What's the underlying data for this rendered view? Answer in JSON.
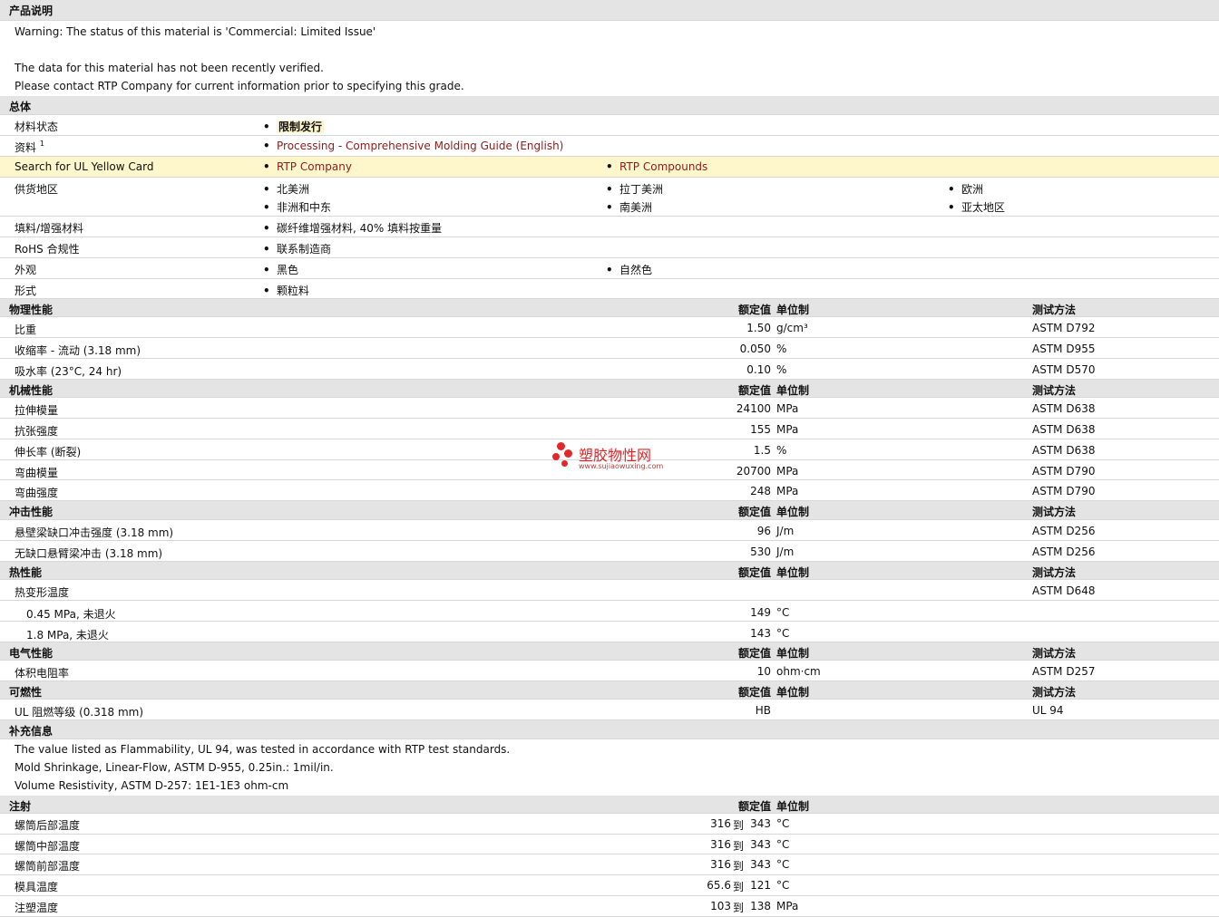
{
  "sections": {
    "product_desc": "产品说明",
    "general": "总体",
    "physical": "物理性能",
    "mechanical": "机械性能",
    "impact": "冲击性能",
    "thermal": "热性能",
    "electrical": "电气性能",
    "flammability": "可燃性",
    "additional": "补充信息",
    "injection": "注射"
  },
  "column_headers": {
    "nominal": "额定值",
    "unit": "单位制",
    "method": "测试方法"
  },
  "product_desc": {
    "line1": "Warning: The status of this material is 'Commercial: Limited Issue'",
    "line2": "The data for this material has not been recently verified.",
    "line3": "Please contact RTP Company for current information prior to specifying this grade."
  },
  "general": {
    "status_label": "材料状态",
    "status_value": "限制发行",
    "docs_label": "资料",
    "docs_sup": "1",
    "docs_link": "Processing - Comprehensive Molding Guide (English)",
    "ul_label": "Search for UL Yellow Card",
    "ul_link1": "RTP Company",
    "ul_link2": "RTP Compounds",
    "supply_label": "供货地区",
    "supply": [
      "北美洲",
      "拉丁美洲",
      "欧洲",
      "非洲和中东",
      "南美洲",
      "亚太地区"
    ],
    "filler_label": "填料/增强材料",
    "filler_value": "碳纤维增强材料, 40% 填料按重量",
    "rohs_label": "RoHS 合规性",
    "rohs_value": "联系制造商",
    "appearance_label": "外观",
    "appearance": [
      "黑色",
      "自然色"
    ],
    "form_label": "形式",
    "form_value": "颗粒料"
  },
  "physical": [
    {
      "name": "比重",
      "value": "1.50",
      "unit": "g/cm³",
      "method": "ASTM D792"
    },
    {
      "name": "收缩率  - 流动  (3.18 mm)",
      "value": "0.050",
      "unit": "%",
      "method": "ASTM D955"
    },
    {
      "name": "吸水率  (23°C, 24 hr)",
      "value": "0.10",
      "unit": "%",
      "method": "ASTM D570"
    }
  ],
  "mechanical": [
    {
      "name": "拉伸模量",
      "value": "24100",
      "unit": "MPa",
      "method": "ASTM D638"
    },
    {
      "name": "抗张强度",
      "value": "155",
      "unit": "MPa",
      "method": "ASTM D638"
    },
    {
      "name": "伸长率  (断裂)",
      "value": "1.5",
      "unit": "%",
      "method": "ASTM D638"
    },
    {
      "name": "弯曲模量",
      "value": "20700",
      "unit": "MPa",
      "method": "ASTM D790"
    },
    {
      "name": "弯曲强度",
      "value": "248",
      "unit": "MPa",
      "method": "ASTM D790"
    }
  ],
  "impact": [
    {
      "name": "悬壁梁缺口冲击强度  (3.18 mm)",
      "value": "96",
      "unit": "J/m",
      "method": "ASTM D256"
    },
    {
      "name": "无缺口悬臂梁冲击  (3.18 mm)",
      "value": "530",
      "unit": "J/m",
      "method": "ASTM D256"
    }
  ],
  "thermal": {
    "hdt_label": "热变形温度",
    "hdt_method": "ASTM D648",
    "rows": [
      {
        "name": "0.45 MPa, 未退火",
        "value": "149",
        "unit": "°C"
      },
      {
        "name": "1.8 MPa, 未退火",
        "value": "143",
        "unit": "°C"
      }
    ]
  },
  "electrical": [
    {
      "name": "体积电阻率",
      "value": "10",
      "unit": "ohm·cm",
      "method": "ASTM D257"
    }
  ],
  "flammability": [
    {
      "name": "UL 阻燃等级  (0.318 mm)",
      "value": "HB",
      "unit": "",
      "method": "UL 94"
    }
  ],
  "additional": {
    "line1": "The value listed as Flammability, UL 94, was tested in accordance with RTP test standards.",
    "line2": "Mold Shrinkage, Linear-Flow, ASTM D-955, 0.25in.: 1mil/in.",
    "line3": "Volume Resistivity, ASTM D-257: 1E1-1E3 ohm-cm"
  },
  "injection": [
    {
      "name": "螺筒后部温度",
      "low": "316",
      "to": "到",
      "high": "343",
      "unit": "°C"
    },
    {
      "name": "螺筒中部温度",
      "low": "316",
      "to": "到",
      "high": "343",
      "unit": "°C"
    },
    {
      "name": "螺筒前部温度",
      "low": "316",
      "to": "到",
      "high": "343",
      "unit": "°C"
    },
    {
      "name": "模具温度",
      "low": "65.6",
      "to": "到",
      "high": "121",
      "unit": "°C"
    },
    {
      "name": "注塑温度",
      "low": "103",
      "to": "到",
      "high": "138",
      "unit": "MPa"
    }
  ],
  "watermark": {
    "title": "塑胶物性网",
    "url": "www.sujiaowuxing.com"
  },
  "colors": {
    "section_bg": "#e4e4e4",
    "highlight_bg": "#fff7cc",
    "link": "#8b1c1c",
    "watermark": "#e3262a"
  }
}
